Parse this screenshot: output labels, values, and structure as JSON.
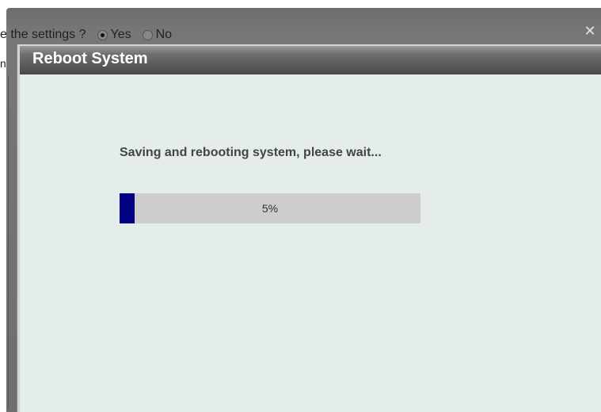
{
  "background_window": {
    "question_text": "e the settings ?",
    "options": [
      {
        "label": "Yes",
        "selected": true
      },
      {
        "label": "No",
        "selected": false
      }
    ],
    "cut_char": "n",
    "close_symbol": "✕"
  },
  "dialog": {
    "title": "Reboot System",
    "status_message": "Saving and rebooting system, please wait...",
    "progress": {
      "percent": 5,
      "label": "5%",
      "fill_color": "#000080",
      "track_color": "#cdcdcd"
    }
  },
  "colors": {
    "dialog_background": "#e4ecec",
    "header_dark": "#484848",
    "title_text": "#ffffff"
  }
}
